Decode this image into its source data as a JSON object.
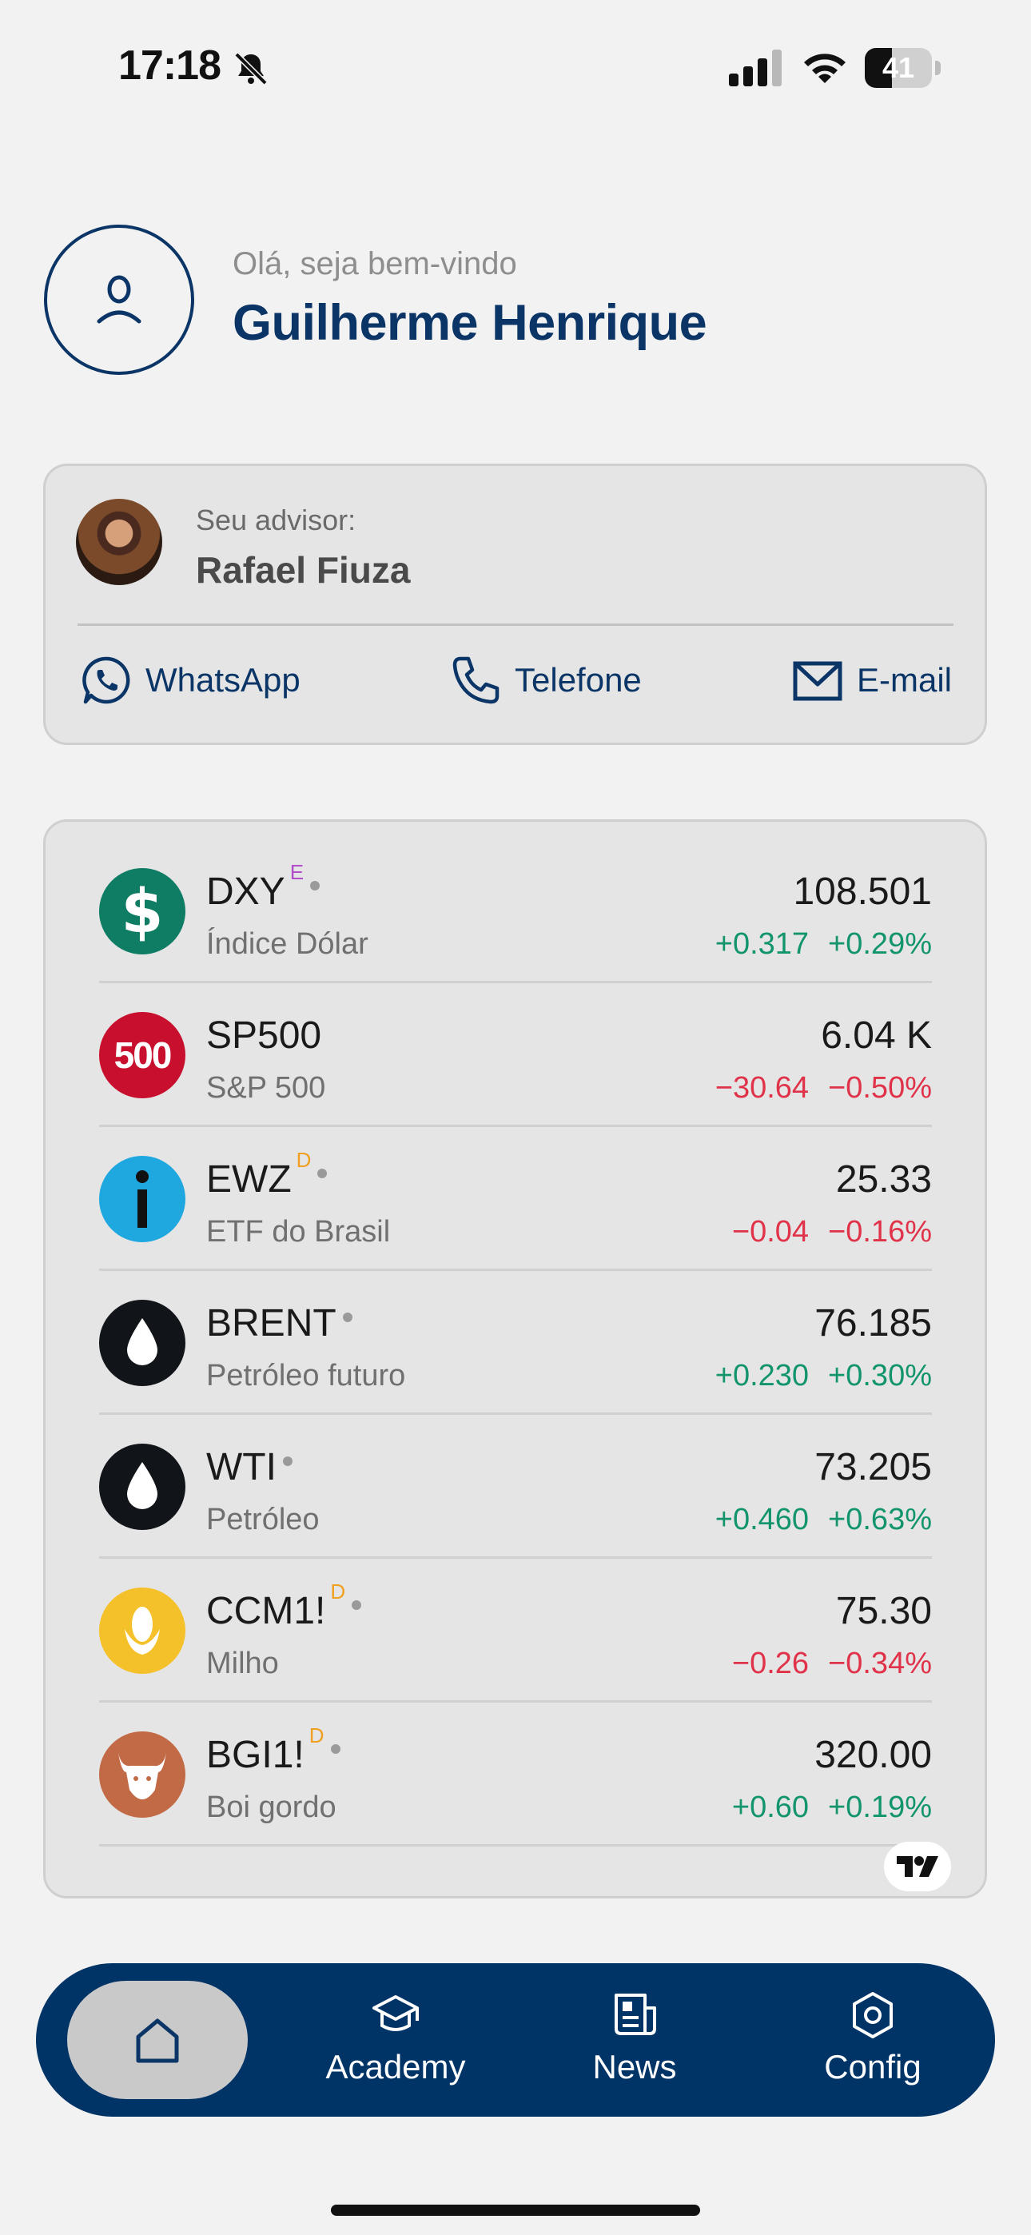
{
  "status_bar": {
    "time": "17:18",
    "battery": "41",
    "battery_level": 0.41
  },
  "header": {
    "greeting": "Olá, seja bem-vindo",
    "user_name": "Guilherme Henrique"
  },
  "advisor": {
    "label": "Seu advisor:",
    "name": "Rafael Fiuza",
    "contacts": {
      "whatsapp": "WhatsApp",
      "phone": "Telefone",
      "email": "E-mail"
    }
  },
  "quotes": [
    {
      "symbol": "DXY",
      "badge": "E",
      "badge_color": "#b04fc8",
      "dot": true,
      "name": "Índice Dólar",
      "price": "108.501",
      "change": "+0.317",
      "change_pct": "+0.29%",
      "direction": "up",
      "logo": "dollar-icon",
      "logo_color": "#0f7d64"
    },
    {
      "symbol": "SP500",
      "badge": "",
      "dot": false,
      "name": "S&P 500",
      "price": "6.04 K",
      "change": "−30.64",
      "change_pct": "−0.50%",
      "direction": "down",
      "logo": "sp500-icon",
      "logo_text": "500",
      "logo_color": "#c8102e"
    },
    {
      "symbol": "EWZ",
      "badge": "D",
      "badge_color": "#f0a020",
      "dot": true,
      "name": "ETF do Brasil",
      "price": "25.33",
      "change": "−0.04",
      "change_pct": "−0.16%",
      "direction": "down",
      "logo": "info-icon",
      "logo_color": "#1fa8e0"
    },
    {
      "symbol": "BRENT",
      "badge": "",
      "dot": true,
      "name": "Petróleo futuro",
      "price": "76.185",
      "change": "+0.230",
      "change_pct": "+0.30%",
      "direction": "up",
      "logo": "oil-drop-icon",
      "logo_color": "#111418"
    },
    {
      "symbol": "WTI",
      "badge": "",
      "dot": true,
      "name": "Petróleo",
      "price": "73.205",
      "change": "+0.460",
      "change_pct": "+0.63%",
      "direction": "up",
      "logo": "oil-drop-icon",
      "logo_color": "#111418"
    },
    {
      "symbol": "CCM1!",
      "badge": "D",
      "badge_color": "#f0a020",
      "dot": true,
      "name": "Milho",
      "price": "75.30",
      "change": "−0.26",
      "change_pct": "−0.34%",
      "direction": "down",
      "logo": "corn-icon",
      "logo_color": "#f5c12a"
    },
    {
      "symbol": "BGI1!",
      "badge": "D",
      "badge_color": "#f0a020",
      "dot": true,
      "name": "Boi gordo",
      "price": "320.00",
      "change": "+0.60",
      "change_pct": "+0.19%",
      "direction": "up",
      "logo": "bull-icon",
      "logo_color": "#c26a45"
    }
  ],
  "nav": {
    "academy": "Academy",
    "news": "News",
    "config": "Config"
  },
  "colors": {
    "primary": "#003366",
    "positive": "#12946c",
    "negative": "#e0334a"
  }
}
